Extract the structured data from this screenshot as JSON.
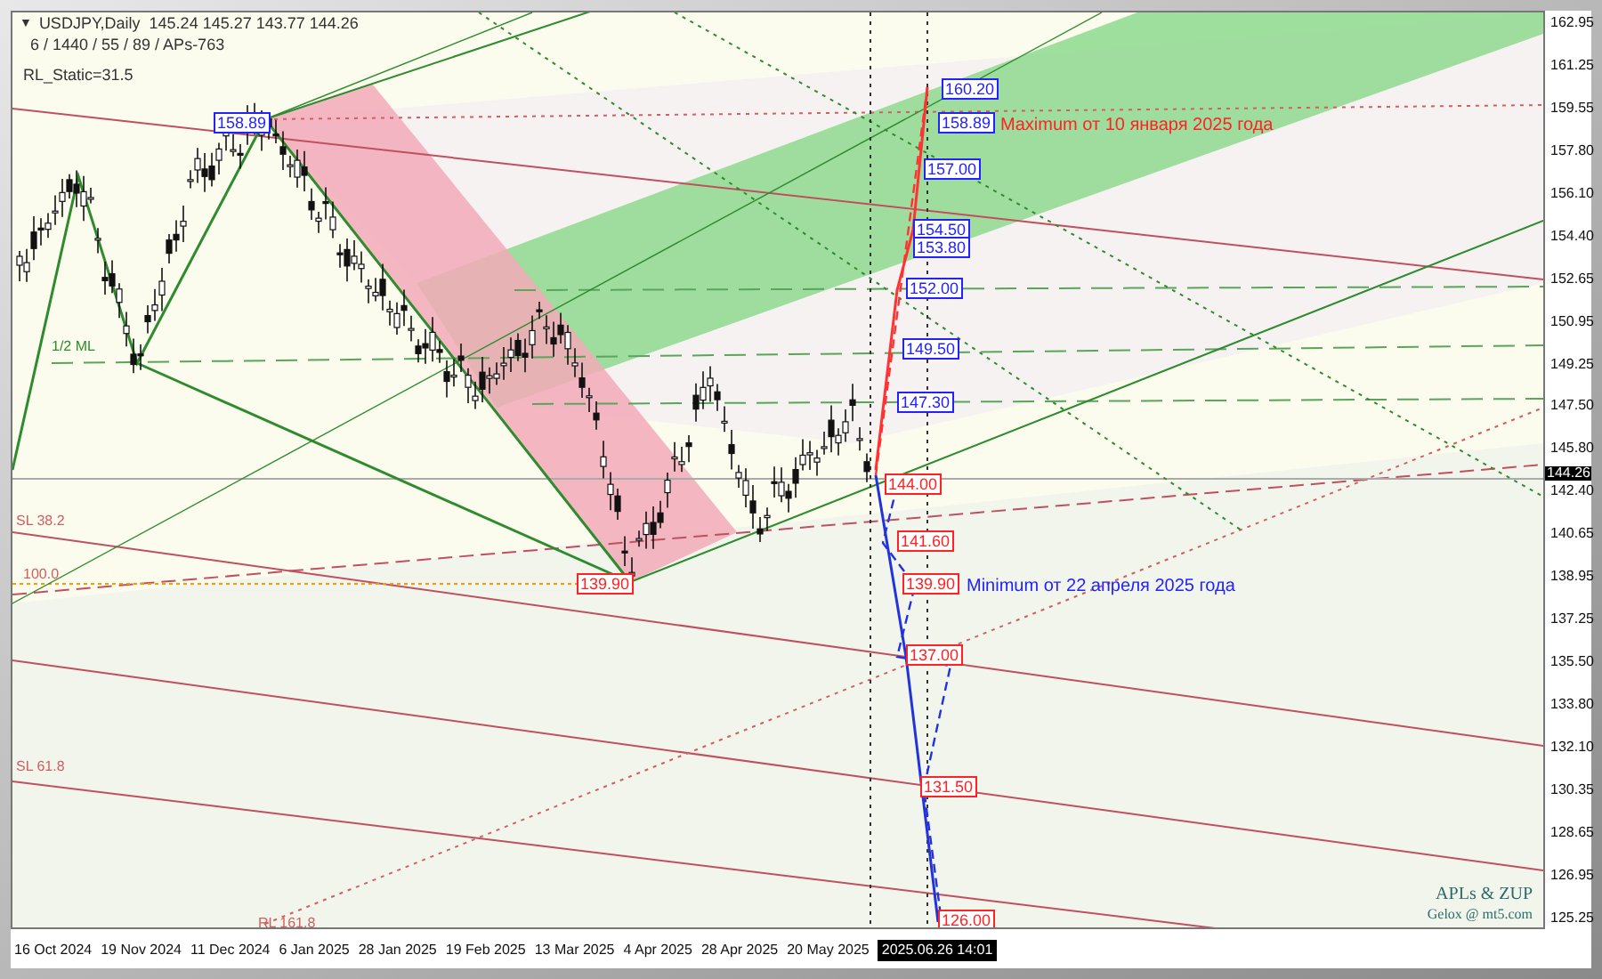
{
  "header": {
    "menu_glyph": "▼",
    "symbol_line": "USDJPY,Daily  145.24 145.27 143.77 144.26",
    "params": "6 / 1440 / 55 / 89 / APs-763",
    "indicator": "RL_Static=31.5"
  },
  "chart_labels": [
    {
      "text": "1/2 ML",
      "color": "#2e8b2e"
    },
    {
      "text": "SL 38.2",
      "color": "#d06060"
    },
    {
      "text": "100.0",
      "color": "#d06060"
    },
    {
      "text": "SL 61.8",
      "color": "#d06060"
    },
    {
      "text": "RL 161.8",
      "color": "#d06060"
    }
  ],
  "price_levels": [
    {
      "text": "158.89",
      "color": "#2222ff"
    },
    {
      "text": "139.90",
      "color": "#ff2222"
    },
    {
      "text": "160.20",
      "color": "#2222ff"
    },
    {
      "text": "158.89",
      "color": "#2222ff"
    },
    {
      "text": "157.00",
      "color": "#2222ff"
    },
    {
      "text": "154.50",
      "color": "#2222ff"
    },
    {
      "text": "153.80",
      "color": "#2222ff"
    },
    {
      "text": "152.00",
      "color": "#2222ff"
    },
    {
      "text": "149.50",
      "color": "#2222ff"
    },
    {
      "text": "147.30",
      "color": "#2222ff"
    },
    {
      "text": "144.00",
      "color": "#ff2222"
    },
    {
      "text": "141.60",
      "color": "#ff2222"
    },
    {
      "text": "139.90",
      "color": "#ff2222"
    },
    {
      "text": "137.00",
      "color": "#ff2222"
    },
    {
      "text": "131.50",
      "color": "#ff2222"
    },
    {
      "text": "126.00",
      "color": "#ff2222"
    }
  ],
  "annotations": [
    {
      "text": "Maximum от 10 января 2025 года",
      "color": "#ff2222"
    },
    {
      "text": "Minimum от 22 апреля 2025 года",
      "color": "#2222ff"
    }
  ],
  "watermark_credit": {
    "title": "APLs & ZUP",
    "subtitle": "Gelox @ mt5.com"
  },
  "price_axis": {
    "labels": [
      "162.95",
      "161.25",
      "159.55",
      "157.80",
      "156.10",
      "154.40",
      "152.65",
      "150.95",
      "149.25",
      "147.50",
      "145.80",
      "142.40",
      "140.65",
      "138.95",
      "137.25",
      "135.50",
      "133.80",
      "132.10",
      "130.35",
      "128.65",
      "126.95",
      "125.25"
    ],
    "current": "144.26"
  },
  "time_axis": {
    "labels": [
      "16 Oct 2024",
      "19 Nov 2024",
      "11 Dec 2024",
      "6 Jan 2025",
      "28 Jan 2025",
      "19 Feb 2025",
      "13 Mar 2025",
      "4 Apr 2025",
      "28 Apr 2025",
      "20 May 2025"
    ],
    "cursor": "2025.06.26 14:01"
  }
}
